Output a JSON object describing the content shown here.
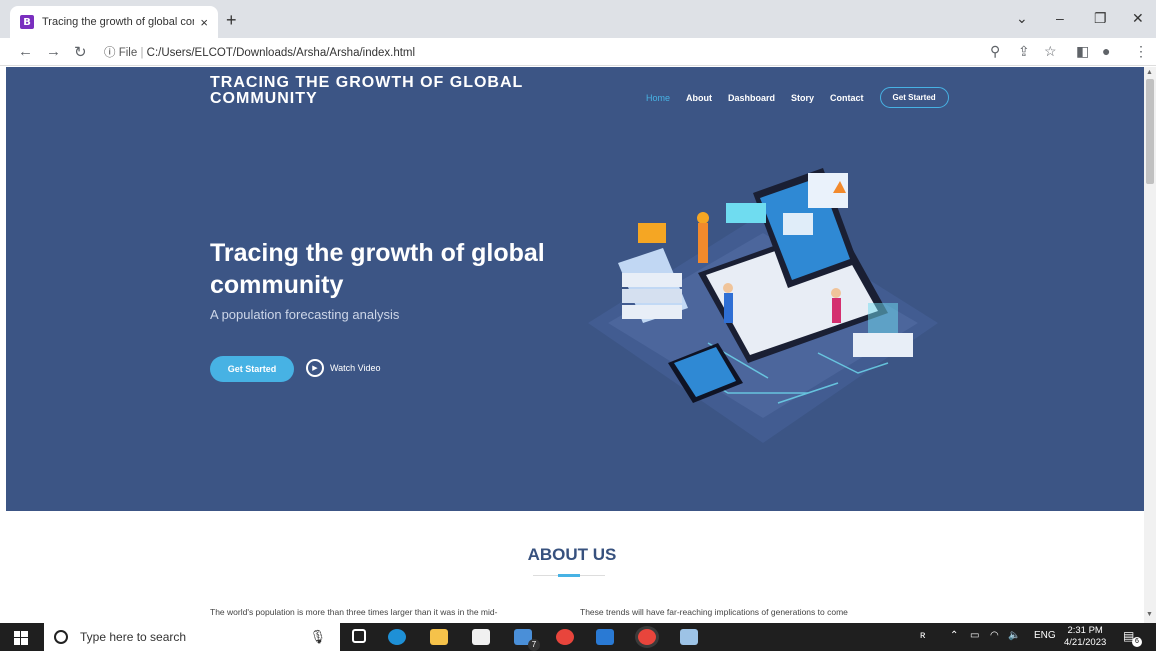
{
  "browser": {
    "tab_title": "Tracing the growth of global con",
    "favicon_letter": "B",
    "close_glyph": "×",
    "new_tab_glyph": "+",
    "url_prefix": "File",
    "url": "C:/Users/ELCOT/Downloads/Arsha/Arsha/index.html"
  },
  "site": {
    "brand": "TRACING THE GROWTH OF GLOBAL COMMUNITY",
    "nav": [
      "Home",
      "About",
      "Dashboard",
      "Story",
      "Contact"
    ],
    "nav_cta": "Get Started",
    "hero_title": "Tracing the growth of global community",
    "hero_subtitle": "A population forecasting analysis",
    "hero_cta": "Get Started",
    "watch_video": "Watch Video",
    "about_title": "ABOUT US",
    "about_para_left": "The world's population is more than three times larger than it was in the mid-",
    "about_para_right": "These trends will have far-reaching implications of generations to come"
  },
  "taskbar": {
    "search_placeholder": "Type here to search",
    "language": "ENG",
    "time": "2:31 PM",
    "date": "4/21/2023",
    "mail_badge": "7",
    "notification_badge": "6"
  },
  "colors": {
    "hero_bg": "#3c5585",
    "accent": "#47b2e4",
    "about_title": "#37517e"
  },
  "icons": [
    "back-icon",
    "forward-icon",
    "reload-icon",
    "info-icon",
    "zoom-icon",
    "share-icon",
    "star-icon",
    "sidebar-icon",
    "profile-icon",
    "menu-icon",
    "windows-icon",
    "mic-icon",
    "task-view-icon",
    "edge-icon",
    "explorer-icon",
    "store-icon",
    "mail-icon",
    "chrome-icon",
    "vscode-icon",
    "notepad-icon"
  ]
}
